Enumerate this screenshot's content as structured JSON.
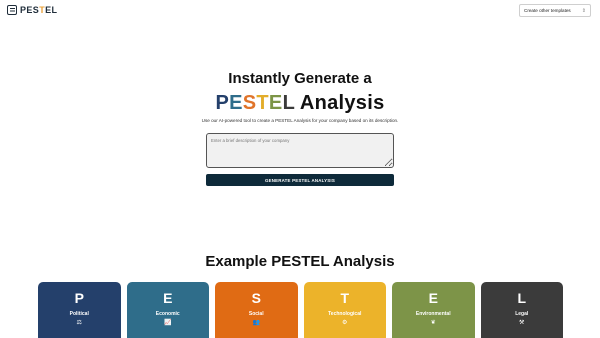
{
  "header": {
    "logo_prefix": "PES",
    "logo_accent": "T",
    "logo_suffix": "EL",
    "template_select": "Create other templates"
  },
  "hero": {
    "line1": "Instantly Generate a",
    "pestel_letters": [
      {
        "char": "P",
        "color": "#24406b"
      },
      {
        "char": "E",
        "color": "#2f6d8a"
      },
      {
        "char": "S",
        "color": "#e0742a"
      },
      {
        "char": "T",
        "color": "#e3ad2a"
      },
      {
        "char": "E",
        "color": "#7c9446"
      },
      {
        "char": "L",
        "color": "#3a3a3a"
      }
    ],
    "analysis_word": "Analysis",
    "subtext": "Use our AI-powered tool to create a PESTEL Analysis for your company based on its description.",
    "input_placeholder": "Enter a brief description of your company",
    "generate_button": "GENERATE PESTEL ANALYSIS"
  },
  "example": {
    "title": "Example PESTEL Analysis",
    "cards": [
      {
        "letter": "P",
        "label": "Political",
        "icon": "scales-icon",
        "glyph": "⚖",
        "color": "#24406b"
      },
      {
        "letter": "E",
        "label": "Economic",
        "icon": "trend-icon",
        "glyph": "📈",
        "color": "#2f6d8a"
      },
      {
        "letter": "S",
        "label": "Social",
        "icon": "people-icon",
        "glyph": "👥",
        "color": "#e06b14"
      },
      {
        "letter": "T",
        "label": "Technological",
        "icon": "gear-icon",
        "glyph": "⚙",
        "color": "#ecb32a"
      },
      {
        "letter": "E",
        "label": "Environmental",
        "icon": "leaf-icon",
        "glyph": "❦",
        "color": "#7d9448"
      },
      {
        "letter": "L",
        "label": "Legal",
        "icon": "gavel-icon",
        "glyph": "⚒",
        "color": "#3b3b3b"
      }
    ]
  }
}
